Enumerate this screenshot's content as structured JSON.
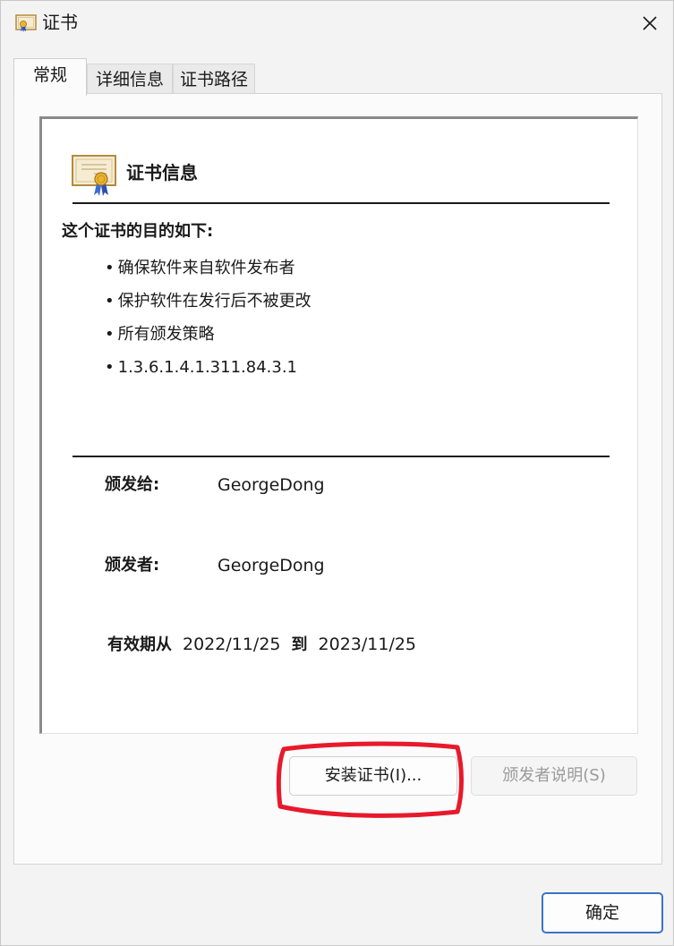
{
  "window": {
    "title": "证书",
    "close_symbol": "✕"
  },
  "tabs": [
    {
      "label": "常规",
      "active": true
    },
    {
      "label": "详细信息",
      "active": false
    },
    {
      "label": "证书路径",
      "active": false
    }
  ],
  "certificate": {
    "heading": "证书信息",
    "purpose_title": "这个证书的目的如下:",
    "purposes": [
      "确保软件来自软件发布者",
      "保护软件在发行后不被更改",
      "所有颁发策略",
      "1.3.6.1.4.1.311.84.3.1"
    ],
    "issued_to_label": "颁发给:",
    "issued_to_value": "GeorgeDong",
    "issued_by_label": "颁发者:",
    "issued_by_value": "GeorgeDong",
    "valid_from_label": "有效期从",
    "valid_from_value": "2022/11/25",
    "valid_to_label": "到",
    "valid_to_value": "2023/11/25"
  },
  "buttons": {
    "install": "安装证书(I)...",
    "issuer_statement": "颁发者说明(S)",
    "ok": "确定"
  },
  "icons": {
    "title": "certificate-icon",
    "heading": "certificate-icon",
    "close": "close-icon"
  },
  "colors": {
    "annotation_red": "#e8192c",
    "ok_border": "#3a74c4"
  }
}
